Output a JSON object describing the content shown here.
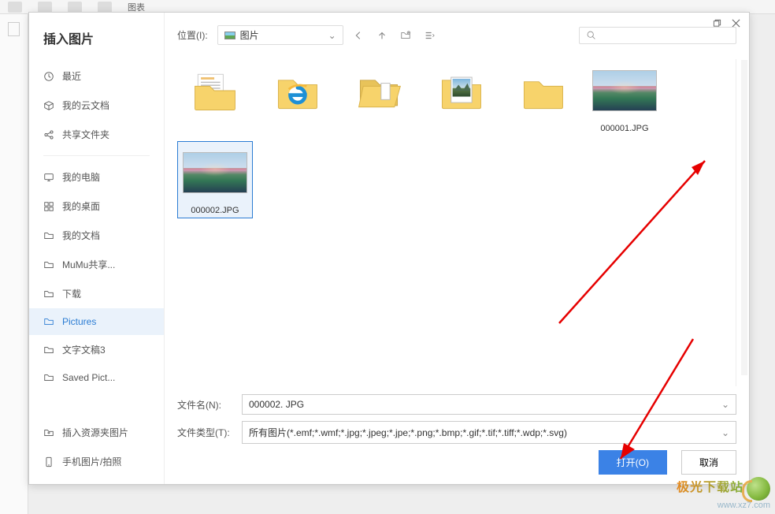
{
  "bg": {
    "ribbon_chart": "图表"
  },
  "dialog": {
    "title": "插入图片",
    "location_label": "位置(I):",
    "location_value": "图片",
    "search_placeholder": "",
    "filename_label": "文件名(N):",
    "filename_value": "000002. JPG",
    "filetype_label": "文件类型(T):",
    "filetype_value": "所有图片(*.emf;*.wmf;*.jpg;*.jpeg;*.jpe;*.png;*.bmp;*.gif;*.tif;*.tiff;*.wdp;*.svg)",
    "open_label": "打开(O)",
    "cancel_label": "取消"
  },
  "nav": {
    "recent": "最近",
    "cloud": "我的云文档",
    "shared": "共享文件夹",
    "computer": "我的电脑",
    "desktop": "我的桌面",
    "documents": "我的文档",
    "mumu": "MuMu共享...",
    "downloads": "下载",
    "pictures": "Pictures",
    "text3": "文字文稿3",
    "saved": "Saved Pict...",
    "resfolder": "插入资源夹图片",
    "phone": "手机图片/拍照"
  },
  "files": [
    {
      "name": "",
      "type": "folder-doc"
    },
    {
      "name": "",
      "type": "folder-ie"
    },
    {
      "name": "",
      "type": "folder-open"
    },
    {
      "name": "",
      "type": "folder-photo"
    },
    {
      "name": "",
      "type": "folder-plain"
    },
    {
      "name": "000001.JPG",
      "type": "photo"
    },
    {
      "name": "000002.JPG",
      "type": "photo",
      "selected": true
    }
  ],
  "watermark": {
    "line1": "极光下载站",
    "line2": "www.xz7.com"
  }
}
